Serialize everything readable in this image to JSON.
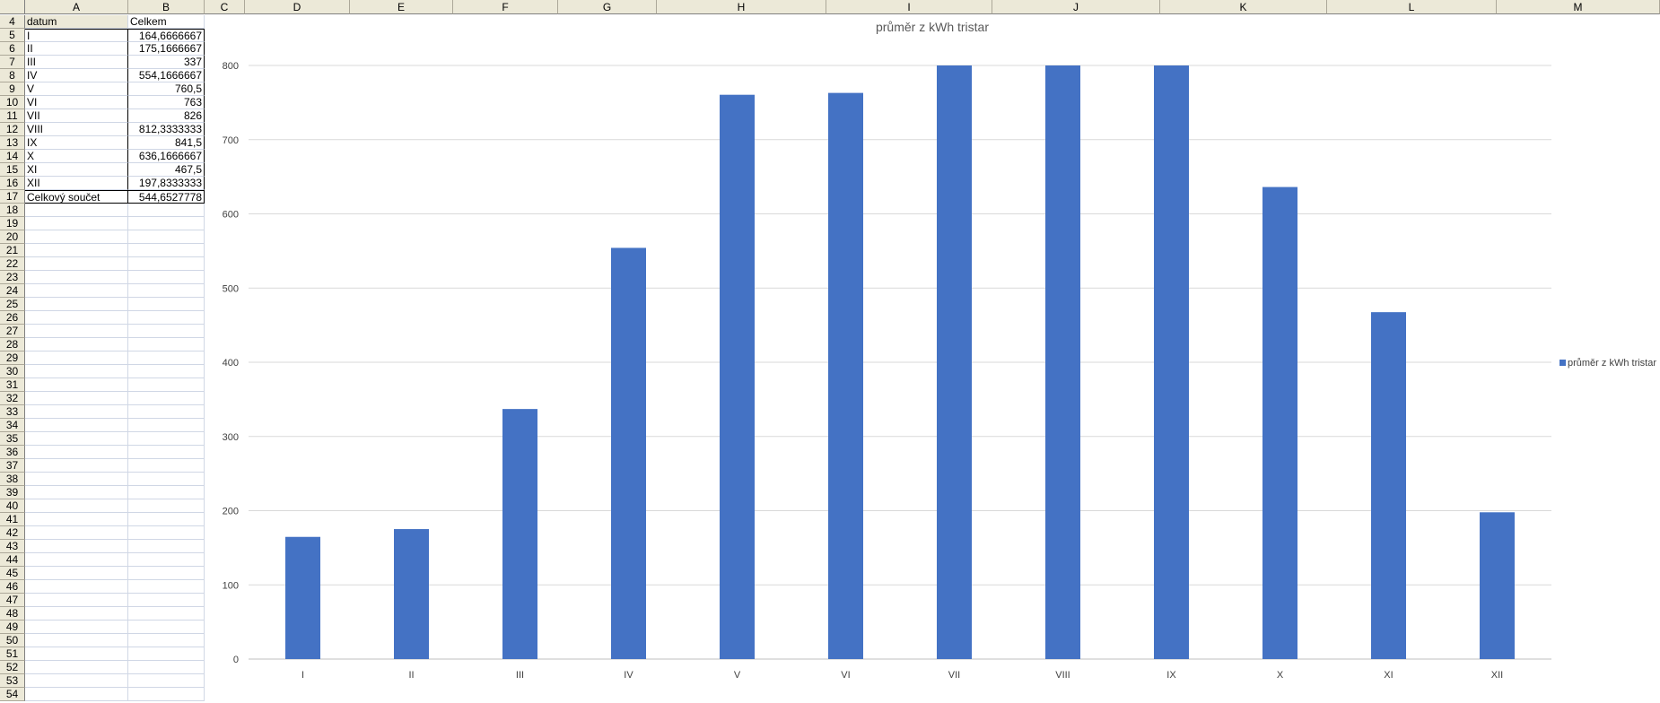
{
  "sheet": {
    "columns": [
      "A",
      "B",
      "C",
      "D",
      "E",
      "F",
      "G",
      "H",
      "I",
      "J",
      "K",
      "L",
      "M"
    ],
    "first_row": 4,
    "last_row": 54,
    "table": {
      "headers": [
        "datum",
        "Celkem"
      ],
      "rows": [
        [
          "I",
          "164,6666667"
        ],
        [
          "II",
          "175,1666667"
        ],
        [
          "III",
          "337"
        ],
        [
          "IV",
          "554,1666667"
        ],
        [
          "V",
          "760,5"
        ],
        [
          "VI",
          "763"
        ],
        [
          "VII",
          "826"
        ],
        [
          "VIII",
          "812,3333333"
        ],
        [
          "IX",
          "841,5"
        ],
        [
          "X",
          "636,1666667"
        ],
        [
          "XI",
          "467,5"
        ],
        [
          "XII",
          "197,8333333"
        ]
      ],
      "total": [
        "Celkový součet",
        "544,6527778"
      ]
    }
  },
  "chart_data": {
    "type": "bar",
    "title": "průměr z kWh tristar",
    "categories": [
      "I",
      "II",
      "III",
      "IV",
      "V",
      "VI",
      "VII",
      "VIII",
      "IX",
      "X",
      "XI",
      "XII"
    ],
    "series": [
      {
        "name": "průměr z kWh tristar",
        "values": [
          164.67,
          175.17,
          337,
          554.17,
          760.5,
          763,
          826,
          812.33,
          841.5,
          636.17,
          467.5,
          197.83
        ],
        "color": "#4472c4"
      }
    ],
    "xlabel": "",
    "ylabel": "",
    "ylim": [
      0,
      800
    ],
    "yticks": [
      0,
      100,
      200,
      300,
      400,
      500,
      600,
      700,
      800
    ],
    "grid": true,
    "legend": "right"
  }
}
